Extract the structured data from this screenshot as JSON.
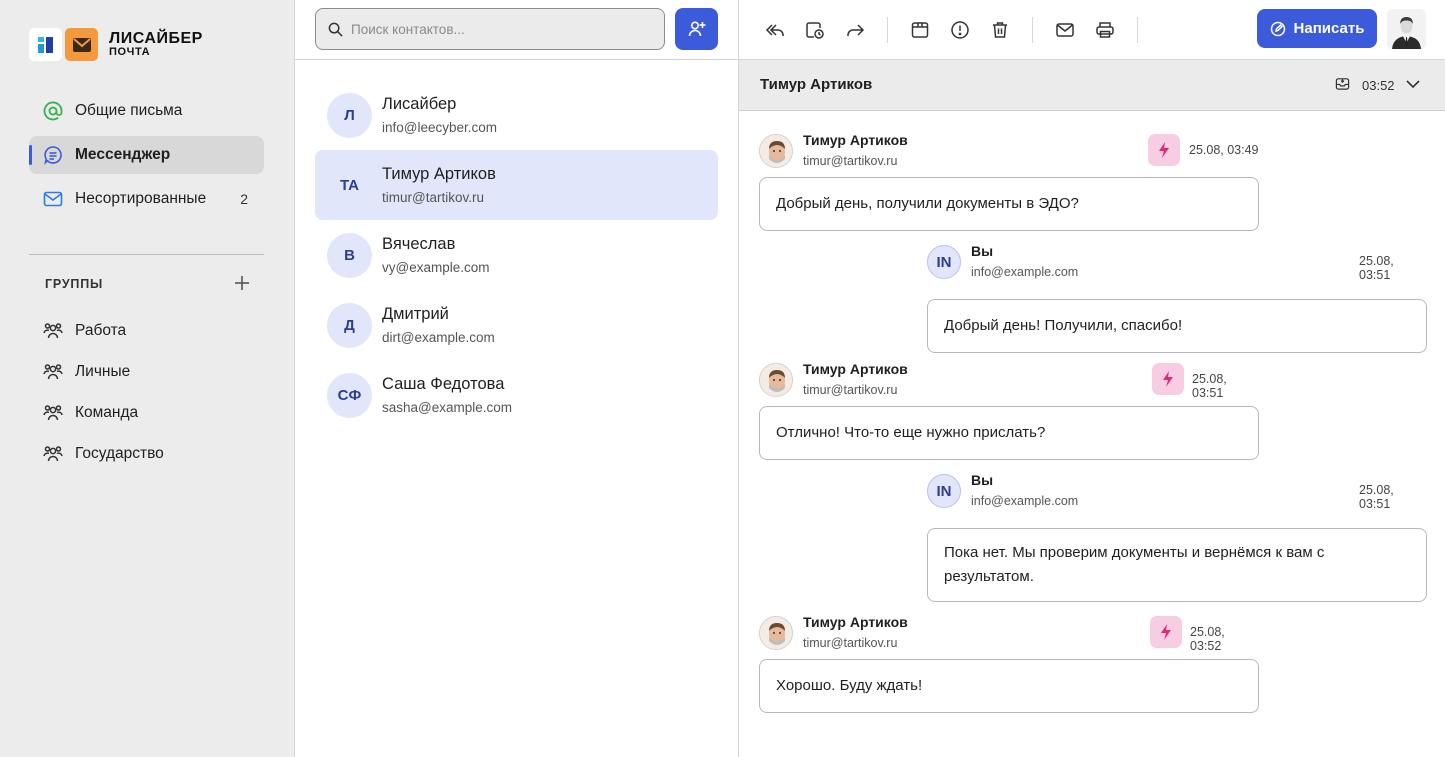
{
  "brand": {
    "title": "ЛИСАЙБЕР",
    "subtitle": "ПОЧТА",
    "colors": {
      "accent": "#3b5bdb",
      "orange": "#f59a3c",
      "lightning": "#e0287a"
    }
  },
  "sidebar": {
    "nav": [
      {
        "label": "Общие письма",
        "icon": "at-icon",
        "badge": ""
      },
      {
        "label": "Мессенджер",
        "icon": "chat-icon",
        "badge": ""
      },
      {
        "label": "Несортированные",
        "icon": "envelope-icon",
        "badge": "2"
      }
    ],
    "groups_title": "ГРУППЫ",
    "groups": [
      {
        "label": "Работа"
      },
      {
        "label": "Личные"
      },
      {
        "label": "Команда"
      },
      {
        "label": "Государство"
      }
    ]
  },
  "contacts": {
    "search_placeholder": "Поиск контактов...",
    "items": [
      {
        "initials": "Л",
        "name": "Лисайбер",
        "email": "info@leecyber.com"
      },
      {
        "initials": "ТА",
        "name": "Тимур Артиков",
        "email": "timur@tartikov.ru"
      },
      {
        "initials": "В",
        "name": "Вячеслав",
        "email": "vy@example.com"
      },
      {
        "initials": "Д",
        "name": "Дмитрий",
        "email": "dirt@example.com"
      },
      {
        "initials": "СФ",
        "name": "Саша Федотова",
        "email": "sasha@example.com"
      }
    ]
  },
  "toolbar": {
    "compose_label": "Написать"
  },
  "chat": {
    "title": "Тимур Артиков",
    "time": "03:52",
    "messages": [
      {
        "sender": "Тимур Артиков",
        "email": "timur@tartikov.ru",
        "time": "25.08, 03:49",
        "text": "Добрый день, получили документы в ЭДО?"
      },
      {
        "sender": "Вы",
        "initials": "IN",
        "email": "info@example.com",
        "time": "25.08, 03:51",
        "text": "Добрый день! Получили, спасибо!"
      },
      {
        "sender": "Тимур Артиков",
        "email": "timur@tartikov.ru",
        "time": "25.08, 03:51",
        "text": "Отлично! Что-то еще нужно прислать?"
      },
      {
        "sender": "Вы",
        "initials": "IN",
        "email": "info@example.com",
        "time": "25.08, 03:51",
        "text": "Пока нет. Мы проверим документы и вернёмся к вам с результатом."
      },
      {
        "sender": "Тимур Артиков",
        "email": "timur@tartikov.ru",
        "time": "25.08, 03:52",
        "text": "Хорошо. Буду ждать!"
      }
    ]
  }
}
